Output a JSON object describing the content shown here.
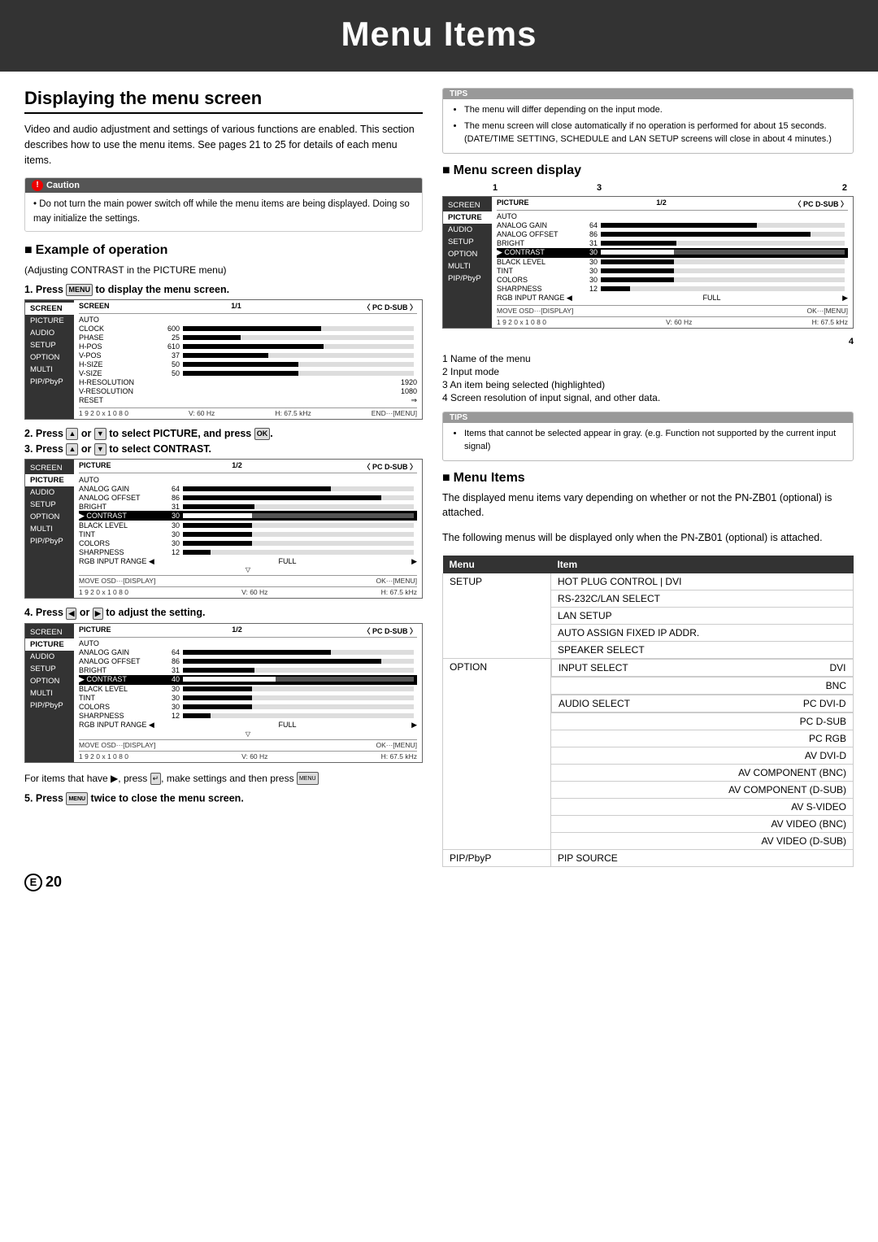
{
  "header": {
    "title": "Menu Items"
  },
  "page": {
    "number": "20",
    "letter": "E"
  },
  "displaying_section": {
    "title": "Displaying the menu screen",
    "intro": "Video and audio adjustment and settings of various functions are enabled. This section describes how to use the menu items. See pages 21 to 25 for details of each menu items."
  },
  "caution": {
    "label": "Caution",
    "text": "Do not turn the main power switch off while the menu items are being displayed. Doing so may initialize the settings."
  },
  "example_section": {
    "title": "Example of operation",
    "subtitle": "(Adjusting CONTRAST in the PICTURE menu)",
    "steps": [
      {
        "number": "1",
        "text": "Press",
        "suffix": "to display the menu screen.",
        "button": "MENU"
      },
      {
        "number": "2",
        "text": "Press",
        "or": "or",
        "suffix": "to select PICTURE, and press",
        "end": "."
      },
      {
        "number": "3",
        "text": "Press",
        "or": "or",
        "suffix": "to select CONTRAST."
      },
      {
        "number": "4",
        "text": "Press",
        "or": "or",
        "suffix": "to adjust the setting."
      },
      {
        "number": "5",
        "text": "Press",
        "button": "MENU",
        "suffix": "twice to close the menu screen."
      }
    ],
    "final_note": "For items that have ▶, press ⌨, make settings and then press"
  },
  "tips_left": {
    "label": "TIPS",
    "items": [
      "The menu will differ depending on the input mode.",
      "The menu screen will close automatically if no operation is performed for about 15 seconds. (DATE/TIME SETTING, SCHEDULE and LAN SETUP screens will close in about 4 minutes.)"
    ]
  },
  "menu_screen_display_section": {
    "title": "Menu screen display",
    "numbers": [
      "1",
      "2",
      "3",
      "4"
    ],
    "notes": [
      "1 Name of the menu",
      "2 Input mode",
      "3 An item being selected (highlighted)",
      "4 Screen resolution of input signal, and other data."
    ]
  },
  "tips_right": {
    "label": "TIPS",
    "items": [
      "Items that cannot be selected appear in gray. (e.g. Function not supported by the current input signal)"
    ]
  },
  "menu_items_section": {
    "title": "Menu Items",
    "intro1": "The displayed menu items vary depending on whether or not the PN-ZB01 (optional) is attached.",
    "intro2": "The following menus will be displayed only when the PN-ZB01 (optional) is attached.",
    "table": {
      "headers": [
        "Menu",
        "Item"
      ],
      "rows": [
        {
          "menu": "SETUP",
          "items": [
            "HOT PLUG CONTROL | DVI",
            "RS-232C/LAN SELECT",
            "LAN SETUP",
            "AUTO ASSIGN FIXED IP ADDR.",
            "SPEAKER SELECT"
          ]
        },
        {
          "menu": "OPTION",
          "subitems": [
            {
              "label": "INPUT SELECT",
              "values": [
                "DVI",
                "BNC"
              ]
            },
            {
              "label": "AUDIO SELECT",
              "values": [
                "PC DVI-D",
                "PC D-SUB",
                "PC RGB",
                "AV DVI-D",
                "AV COMPONENT (BNC)",
                "AV COMPONENT (D-SUB)",
                "AV S-VIDEO",
                "AV VIDEO (BNC)",
                "AV VIDEO (D-SUB)"
              ]
            }
          ]
        },
        {
          "menu": "PIP/PbyP",
          "items": [
            "PIP SOURCE"
          ]
        }
      ]
    }
  },
  "screen1": {
    "title": "SCREEN",
    "page": "1/1",
    "input": "〈 PC D-SUB 〉",
    "sidebar": [
      "SCREEN",
      "PICTURE",
      "AUDIO",
      "SETUP",
      "OPTION",
      "MULTI",
      "PIP/PbyP"
    ],
    "active": "SCREEN",
    "rows": [
      {
        "label": "AUTO",
        "value": ""
      },
      {
        "label": "CLOCK",
        "value": "600"
      },
      {
        "label": "PHASE",
        "value": "25"
      },
      {
        "label": "H-POS",
        "value": "610"
      },
      {
        "label": "V-POS",
        "value": "37"
      },
      {
        "label": "H-SIZE",
        "value": "50"
      },
      {
        "label": "V-SIZE",
        "value": "50"
      },
      {
        "label": "H-RESOLUTION",
        "value": "1920"
      },
      {
        "label": "V-RESOLUTION",
        "value": "1080"
      },
      {
        "label": "RESET",
        "value": "⇒"
      }
    ],
    "footer_left": "1 9 2 0 x 1 0 8 0",
    "footer_mid": "V: 60 Hz",
    "footer_right": "H: 67.5 kHz",
    "end_label": "END···[MENU]"
  },
  "screen2": {
    "title": "PICTURE",
    "page": "1/2",
    "input": "〈 PC D-SUB 〉",
    "sidebar": [
      "SCREEN",
      "PICTURE",
      "AUDIO",
      "SETUP",
      "OPTION",
      "MULTI",
      "PIP/PbyP"
    ],
    "active": "PICTURE",
    "rows": [
      {
        "label": "AUTO",
        "value": "",
        "selected": false
      },
      {
        "label": "ANALOG GAIN",
        "value": "64",
        "selected": false
      },
      {
        "label": "ANALOG OFFSET",
        "value": "86",
        "selected": false
      },
      {
        "label": "BRIGHT",
        "value": "31",
        "selected": false
      },
      {
        "label": "▶ CONTRAST",
        "value": "30",
        "selected": true
      },
      {
        "label": "BLACK LEVEL",
        "value": "30",
        "selected": false
      },
      {
        "label": "TINT",
        "value": "30",
        "selected": false
      },
      {
        "label": "COLORS",
        "value": "30",
        "selected": false
      },
      {
        "label": "SHARPNESS",
        "value": "12",
        "selected": false
      },
      {
        "label": "RGB INPUT RANGE ◀",
        "value": "FULL",
        "extra": "▶",
        "selected": false
      }
    ],
    "footer_left": "MOVE OSD···[DISPLAY]",
    "footer_right": "OK···[MENU]",
    "footer_res": "1 9 2 0 x 1 0 8 0",
    "footer_v": "V: 60 Hz",
    "footer_h": "H: 67.5 kHz"
  },
  "screen3": {
    "title": "PICTURE",
    "page": "1/2",
    "input": "〈 PC D-SUB 〉",
    "sidebar": [
      "SCREEN",
      "PICTURE",
      "AUDIO",
      "SETUP",
      "OPTION",
      "MULTI",
      "PIP/PbyP"
    ],
    "active": "PICTURE",
    "rows": [
      {
        "label": "AUTO",
        "value": "",
        "selected": false
      },
      {
        "label": "ANALOG GAIN",
        "value": "64",
        "selected": false
      },
      {
        "label": "ANALOG OFFSET",
        "value": "86",
        "selected": false
      },
      {
        "label": "BRIGHT",
        "value": "31",
        "selected": false
      },
      {
        "label": "▶ CONTRAST",
        "value": "40",
        "selected": true
      },
      {
        "label": "BLACK LEVEL",
        "value": "30",
        "selected": false
      },
      {
        "label": "TINT",
        "value": "30",
        "selected": false
      },
      {
        "label": "COLORS",
        "value": "30",
        "selected": false
      },
      {
        "label": "SHARPNESS",
        "value": "12",
        "selected": false
      },
      {
        "label": "RGB INPUT RANGE ◀",
        "value": "FULL",
        "extra": "▶",
        "selected": false
      }
    ],
    "footer_left": "MOVE OSD···[DISPLAY]",
    "footer_right": "OK···[MENU]",
    "footer_res": "1 9 2 0 x 1 0 8 0",
    "footer_v": "V: 60 Hz",
    "footer_h": "H: 67.5 kHz"
  },
  "screen_right": {
    "title": "PICTURE",
    "page": "1/2",
    "input": "〈 PC D-SUB 〉",
    "sidebar": [
      "SCREEN",
      "PICTURE",
      "AUDIO",
      "SETUP",
      "OPTION",
      "MULTI",
      "PIP/PbyP"
    ],
    "active": "PICTURE",
    "rows": [
      {
        "label": "AUTO",
        "value": "",
        "selected": false
      },
      {
        "label": "ANALOG GAIN",
        "value": "64",
        "selected": false
      },
      {
        "label": "ANALOG OFFSET",
        "value": "86",
        "selected": false
      },
      {
        "label": "BRIGHT",
        "value": "31",
        "selected": false
      },
      {
        "label": "▶ CONTRAST",
        "value": "30",
        "selected": true
      },
      {
        "label": "BLACK LEVEL",
        "value": "30",
        "selected": false
      },
      {
        "label": "TINT",
        "value": "30",
        "selected": false
      },
      {
        "label": "COLORS",
        "value": "30",
        "selected": false
      },
      {
        "label": "SHARPNESS",
        "value": "12",
        "selected": false
      },
      {
        "label": "RGB INPUT RANGE ◀",
        "value": "FULL",
        "extra": "▶",
        "selected": false
      }
    ],
    "footer_left": "MOVE OSD···[DISPLAY]",
    "footer_right": "OK···[MENU]",
    "footer_res": "1 9 2 0 x 1 0 8 0",
    "footer_v": "V: 60 Hz",
    "footer_h": "H: 67.5 kHz"
  }
}
